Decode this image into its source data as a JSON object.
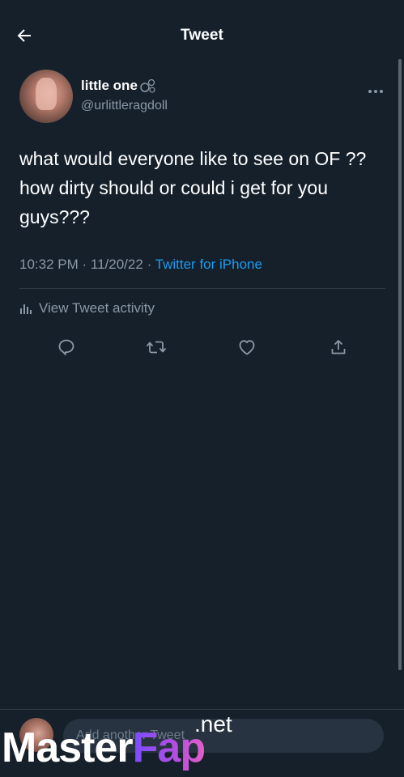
{
  "header": {
    "title": "Tweet"
  },
  "author": {
    "display_name": "little one",
    "handle": "@urlittleragdoll"
  },
  "tweet": {
    "text": "what would everyone like to see on OF ?? how dirty should or could i get for you guys???",
    "time": "10:32 PM",
    "separator": "·",
    "date": "11/20/22",
    "source": "Twitter for iPhone"
  },
  "activity": {
    "label": "View Tweet activity"
  },
  "actions": {
    "reply": "reply-icon",
    "retweet": "retweet-icon",
    "like": "heart-icon",
    "share": "share-icon"
  },
  "reply_bar": {
    "placeholder": "Add another Tweet"
  },
  "watermark": {
    "brand_part1": "Master",
    "brand_part2": "Fap",
    "suffix": ".net"
  },
  "colors": {
    "background": "#15202b",
    "accent": "#1d9bf0",
    "secondary_text": "#8b98a5",
    "divider": "#2f3a45"
  }
}
